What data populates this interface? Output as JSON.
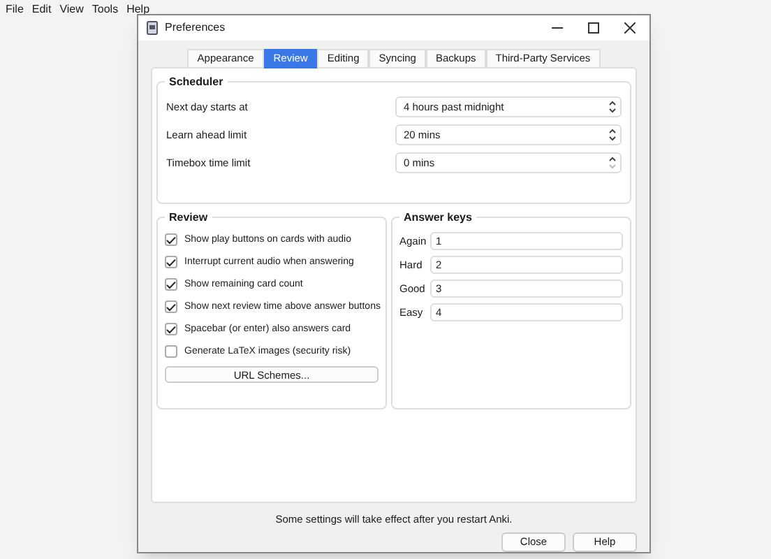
{
  "menu": [
    "File",
    "Edit",
    "View",
    "Tools",
    "Help"
  ],
  "window": {
    "title": "Preferences"
  },
  "tabs": [
    {
      "label": "Appearance",
      "selected": false
    },
    {
      "label": "Review",
      "selected": true
    },
    {
      "label": "Editing",
      "selected": false
    },
    {
      "label": "Syncing",
      "selected": false
    },
    {
      "label": "Backups",
      "selected": false
    },
    {
      "label": "Third-Party Services",
      "selected": false
    }
  ],
  "scheduler": {
    "title": "Scheduler",
    "rows": [
      {
        "label": "Next day starts at",
        "value": "4 hours past midnight",
        "down_disabled": false
      },
      {
        "label": "Learn ahead limit",
        "value": "20 mins",
        "down_disabled": false
      },
      {
        "label": "Timebox time limit",
        "value": "0 mins",
        "down_disabled": true
      }
    ]
  },
  "review": {
    "title": "Review",
    "options": [
      {
        "label": "Show play buttons on cards with audio",
        "checked": true
      },
      {
        "label": "Interrupt current audio when answering",
        "checked": true
      },
      {
        "label": "Show remaining card count",
        "checked": true
      },
      {
        "label": "Show next review time above answer buttons",
        "checked": true
      },
      {
        "label": "Spacebar (or enter) also answers card",
        "checked": true
      },
      {
        "label": "Generate LaTeX images (security risk)",
        "checked": false
      }
    ],
    "button": "URL Schemes..."
  },
  "answer_keys": {
    "title": "Answer keys",
    "keys": [
      {
        "label": "Again",
        "value": "1"
      },
      {
        "label": "Hard",
        "value": "2"
      },
      {
        "label": "Good",
        "value": "3"
      },
      {
        "label": "Easy",
        "value": "4"
      }
    ]
  },
  "footer_note": "Some settings will take effect after you restart Anki.",
  "buttons": [
    "Close",
    "Help"
  ]
}
